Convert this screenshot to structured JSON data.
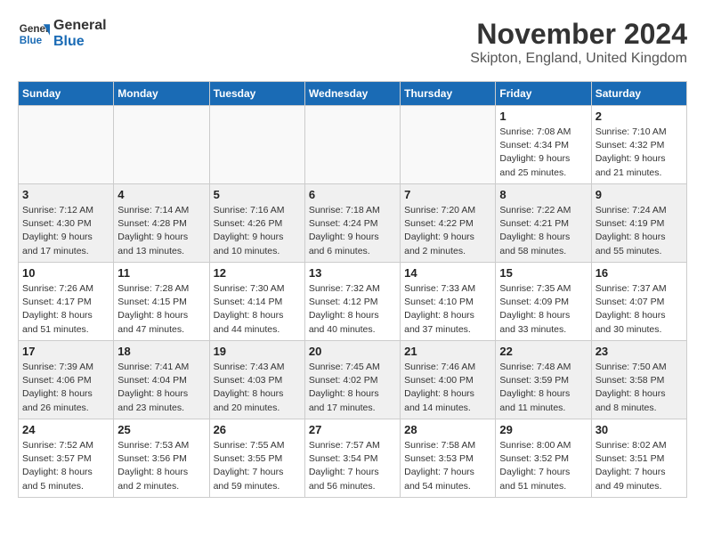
{
  "header": {
    "logo_line1": "General",
    "logo_line2": "Blue",
    "month_title": "November 2024",
    "location": "Skipton, England, United Kingdom"
  },
  "days_of_week": [
    "Sunday",
    "Monday",
    "Tuesday",
    "Wednesday",
    "Thursday",
    "Friday",
    "Saturday"
  ],
  "weeks": [
    [
      {
        "day": "",
        "info": ""
      },
      {
        "day": "",
        "info": ""
      },
      {
        "day": "",
        "info": ""
      },
      {
        "day": "",
        "info": ""
      },
      {
        "day": "",
        "info": ""
      },
      {
        "day": "1",
        "info": "Sunrise: 7:08 AM\nSunset: 4:34 PM\nDaylight: 9 hours\nand 25 minutes."
      },
      {
        "day": "2",
        "info": "Sunrise: 7:10 AM\nSunset: 4:32 PM\nDaylight: 9 hours\nand 21 minutes."
      }
    ],
    [
      {
        "day": "3",
        "info": "Sunrise: 7:12 AM\nSunset: 4:30 PM\nDaylight: 9 hours\nand 17 minutes."
      },
      {
        "day": "4",
        "info": "Sunrise: 7:14 AM\nSunset: 4:28 PM\nDaylight: 9 hours\nand 13 minutes."
      },
      {
        "day": "5",
        "info": "Sunrise: 7:16 AM\nSunset: 4:26 PM\nDaylight: 9 hours\nand 10 minutes."
      },
      {
        "day": "6",
        "info": "Sunrise: 7:18 AM\nSunset: 4:24 PM\nDaylight: 9 hours\nand 6 minutes."
      },
      {
        "day": "7",
        "info": "Sunrise: 7:20 AM\nSunset: 4:22 PM\nDaylight: 9 hours\nand 2 minutes."
      },
      {
        "day": "8",
        "info": "Sunrise: 7:22 AM\nSunset: 4:21 PM\nDaylight: 8 hours\nand 58 minutes."
      },
      {
        "day": "9",
        "info": "Sunrise: 7:24 AM\nSunset: 4:19 PM\nDaylight: 8 hours\nand 55 minutes."
      }
    ],
    [
      {
        "day": "10",
        "info": "Sunrise: 7:26 AM\nSunset: 4:17 PM\nDaylight: 8 hours\nand 51 minutes."
      },
      {
        "day": "11",
        "info": "Sunrise: 7:28 AM\nSunset: 4:15 PM\nDaylight: 8 hours\nand 47 minutes."
      },
      {
        "day": "12",
        "info": "Sunrise: 7:30 AM\nSunset: 4:14 PM\nDaylight: 8 hours\nand 44 minutes."
      },
      {
        "day": "13",
        "info": "Sunrise: 7:32 AM\nSunset: 4:12 PM\nDaylight: 8 hours\nand 40 minutes."
      },
      {
        "day": "14",
        "info": "Sunrise: 7:33 AM\nSunset: 4:10 PM\nDaylight: 8 hours\nand 37 minutes."
      },
      {
        "day": "15",
        "info": "Sunrise: 7:35 AM\nSunset: 4:09 PM\nDaylight: 8 hours\nand 33 minutes."
      },
      {
        "day": "16",
        "info": "Sunrise: 7:37 AM\nSunset: 4:07 PM\nDaylight: 8 hours\nand 30 minutes."
      }
    ],
    [
      {
        "day": "17",
        "info": "Sunrise: 7:39 AM\nSunset: 4:06 PM\nDaylight: 8 hours\nand 26 minutes."
      },
      {
        "day": "18",
        "info": "Sunrise: 7:41 AM\nSunset: 4:04 PM\nDaylight: 8 hours\nand 23 minutes."
      },
      {
        "day": "19",
        "info": "Sunrise: 7:43 AM\nSunset: 4:03 PM\nDaylight: 8 hours\nand 20 minutes."
      },
      {
        "day": "20",
        "info": "Sunrise: 7:45 AM\nSunset: 4:02 PM\nDaylight: 8 hours\nand 17 minutes."
      },
      {
        "day": "21",
        "info": "Sunrise: 7:46 AM\nSunset: 4:00 PM\nDaylight: 8 hours\nand 14 minutes."
      },
      {
        "day": "22",
        "info": "Sunrise: 7:48 AM\nSunset: 3:59 PM\nDaylight: 8 hours\nand 11 minutes."
      },
      {
        "day": "23",
        "info": "Sunrise: 7:50 AM\nSunset: 3:58 PM\nDaylight: 8 hours\nand 8 minutes."
      }
    ],
    [
      {
        "day": "24",
        "info": "Sunrise: 7:52 AM\nSunset: 3:57 PM\nDaylight: 8 hours\nand 5 minutes."
      },
      {
        "day": "25",
        "info": "Sunrise: 7:53 AM\nSunset: 3:56 PM\nDaylight: 8 hours\nand 2 minutes."
      },
      {
        "day": "26",
        "info": "Sunrise: 7:55 AM\nSunset: 3:55 PM\nDaylight: 7 hours\nand 59 minutes."
      },
      {
        "day": "27",
        "info": "Sunrise: 7:57 AM\nSunset: 3:54 PM\nDaylight: 7 hours\nand 56 minutes."
      },
      {
        "day": "28",
        "info": "Sunrise: 7:58 AM\nSunset: 3:53 PM\nDaylight: 7 hours\nand 54 minutes."
      },
      {
        "day": "29",
        "info": "Sunrise: 8:00 AM\nSunset: 3:52 PM\nDaylight: 7 hours\nand 51 minutes."
      },
      {
        "day": "30",
        "info": "Sunrise: 8:02 AM\nSunset: 3:51 PM\nDaylight: 7 hours\nand 49 minutes."
      }
    ]
  ]
}
